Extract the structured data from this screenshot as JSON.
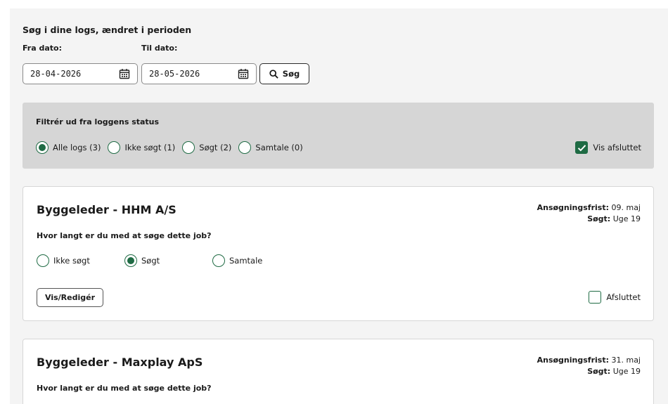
{
  "search": {
    "title": "Søg i dine logs, ændret i perioden",
    "from_label": "Fra dato:",
    "to_label": "Til dato:",
    "from_value": "28-04-2026",
    "to_value": "28-05-2026",
    "button_label": "Søg"
  },
  "filter": {
    "title": "Filtrér ud fra loggens status",
    "options": [
      {
        "label": "Alle logs (3)",
        "checked": true
      },
      {
        "label": "Ikke søgt (1)",
        "checked": false
      },
      {
        "label": "Søgt (2)",
        "checked": false
      },
      {
        "label": "Samtale (0)",
        "checked": false
      }
    ],
    "show_closed_label": "Vis afsluttet",
    "show_closed_checked": true
  },
  "jobs": [
    {
      "title": "Byggeleder - HHM A/S",
      "deadline_label": "Ansøgningsfrist:",
      "deadline_value": "09. maj",
      "applied_label": "Søgt:",
      "applied_value": "Uge 19",
      "question": "Hvor langt er du med at søge dette job?",
      "options": [
        "Ikke søgt",
        "Søgt",
        "Samtale"
      ],
      "selected": 1,
      "edit_label": "Vis/Redigér",
      "closed_label": "Afsluttet"
    },
    {
      "title": "Byggeleder - Maxplay ApS",
      "deadline_label": "Ansøgningsfrist:",
      "deadline_value": "31. maj",
      "applied_label": "Søgt:",
      "applied_value": "Uge 19",
      "question": "Hvor langt er du med at søge dette job?"
    }
  ],
  "colors": {
    "accent": "#1f6b44",
    "page_bg": "#f4f4f4",
    "panel_bg": "#d6d6d6"
  }
}
